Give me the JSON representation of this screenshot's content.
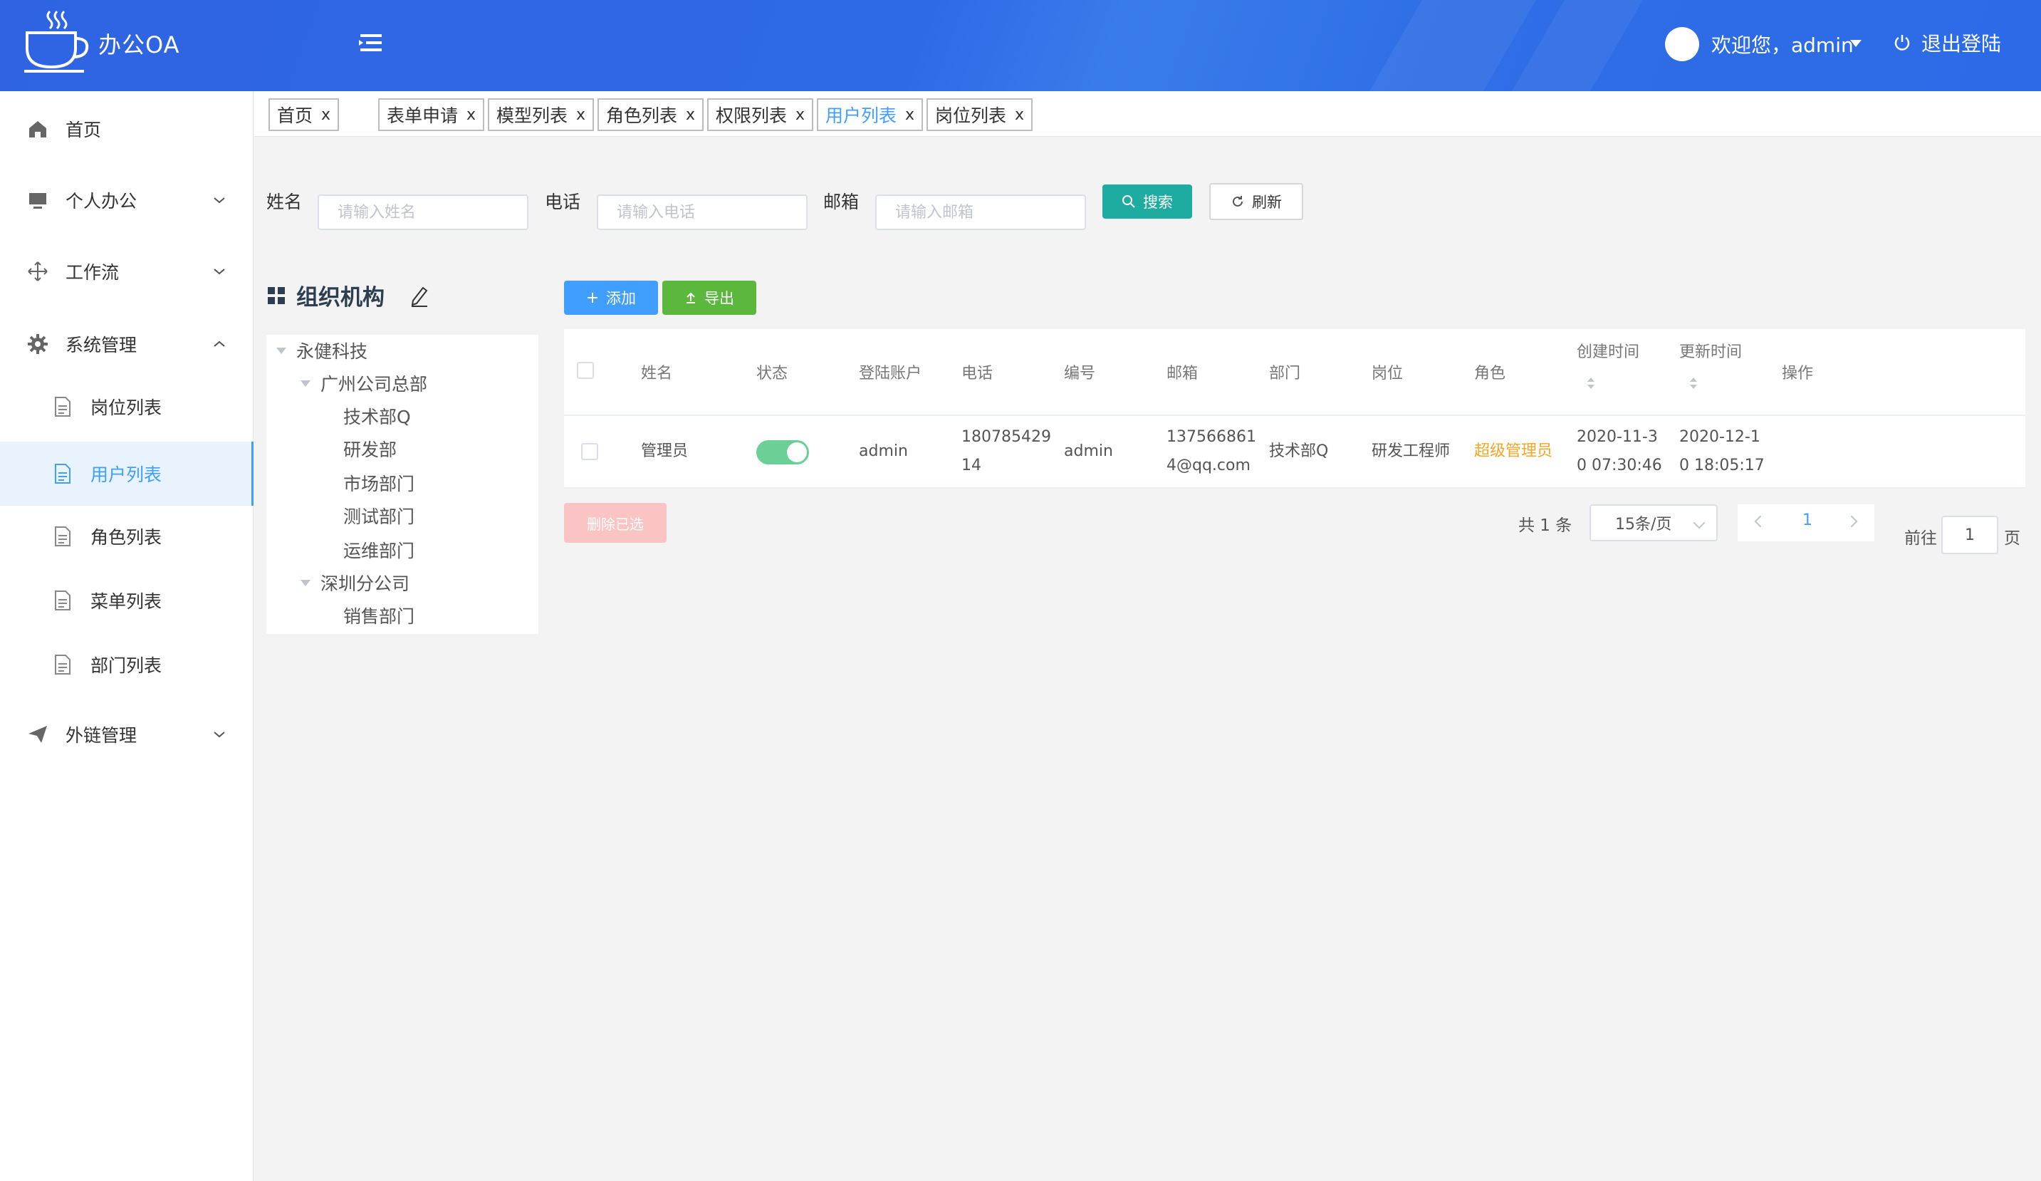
{
  "header": {
    "app_title": "办公OA",
    "welcome": "欢迎您，admin",
    "logout": "退出登陆",
    "brand_color": "#2f6ae6"
  },
  "sidebar": {
    "items": [
      {
        "label": "首页",
        "icon": "home-icon"
      },
      {
        "label": "个人办公",
        "icon": "monitor-icon"
      },
      {
        "label": "工作流",
        "icon": "move-icon"
      },
      {
        "label": "系统管理",
        "icon": "gear-icon"
      },
      {
        "label": "外链管理",
        "icon": "send-icon"
      }
    ],
    "sub_items": [
      {
        "label": "岗位列表"
      },
      {
        "label": "用户列表",
        "active": true
      },
      {
        "label": "角色列表"
      },
      {
        "label": "菜单列表"
      },
      {
        "label": "部门列表"
      }
    ]
  },
  "tabs": [
    {
      "label": "首页"
    },
    {
      "label": "表单申请"
    },
    {
      "label": "模型列表"
    },
    {
      "label": "角色列表"
    },
    {
      "label": "权限列表"
    },
    {
      "label": "用户列表",
      "active": true
    },
    {
      "label": "岗位列表"
    }
  ],
  "tab_close": "x",
  "search": {
    "name_label": "姓名",
    "name_placeholder": "请输入姓名",
    "phone_label": "电话",
    "phone_placeholder": "请输入电话",
    "email_label": "邮箱",
    "email_placeholder": "请输入邮箱",
    "search_btn": "搜索",
    "refresh_btn": "刷新"
  },
  "org": {
    "title": "组织机构",
    "tree": [
      {
        "label": "永健科技",
        "level": 0,
        "expanded": true
      },
      {
        "label": "广州公司总部",
        "level": 1,
        "expanded": true
      },
      {
        "label": "技术部Q",
        "level": 2
      },
      {
        "label": "研发部",
        "level": 2
      },
      {
        "label": "市场部门",
        "level": 2
      },
      {
        "label": "测试部门",
        "level": 2
      },
      {
        "label": "运维部门",
        "level": 2
      },
      {
        "label": "深圳分公司",
        "level": 1,
        "expanded": true
      },
      {
        "label": "销售部门",
        "level": 2
      }
    ]
  },
  "actions": {
    "add": "添加",
    "export": "导出",
    "delete_selected": "删除已选"
  },
  "table": {
    "columns": [
      "姓名",
      "状态",
      "登陆账户",
      "电话",
      "编号",
      "邮箱",
      "部门",
      "岗位",
      "角色",
      "创建时间",
      "更新时间",
      "操作"
    ],
    "rows": [
      {
        "name": "管理员",
        "status": true,
        "account": "admin",
        "phone_l1": "180785429",
        "phone_l2": "14",
        "number": "admin",
        "email_l1": "137566861",
        "email_l2": "4@qq.com",
        "dept": "技术部Q",
        "post": "研发工程师",
        "role": "超级管理员",
        "created_l1": "2020-11-3",
        "created_l2": "0 07:30:46",
        "updated_l1": "2020-12-1",
        "updated_l2": "0 18:05:17"
      }
    ],
    "role_color": "#f5a623",
    "toggle_color": "#6ad096"
  },
  "pagination": {
    "total": "共 1 条",
    "page_size": "15条/页",
    "current": "1",
    "goto_label": "前往",
    "goto_value": "1",
    "page_suffix": "页"
  }
}
